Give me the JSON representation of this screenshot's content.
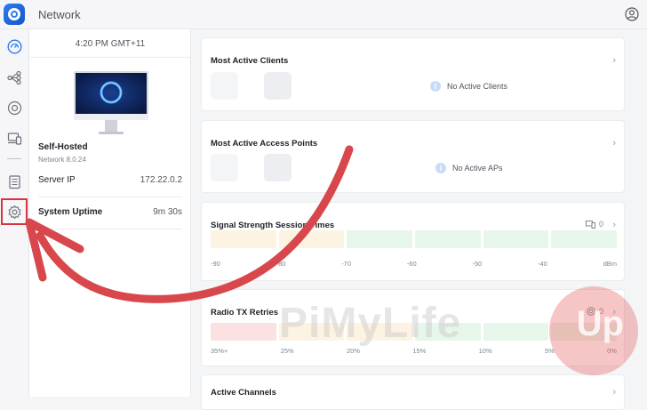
{
  "app": {
    "title": "Network"
  },
  "info": {
    "clock": "4:20 PM GMT+11",
    "device_name": "Self-Hosted",
    "device_version": "Network 8.0.24",
    "rows": [
      {
        "label": "Server IP",
        "value": "172.22.0.2"
      },
      {
        "label": "System Uptime",
        "value": "9m 30s"
      }
    ]
  },
  "cards": {
    "clients": {
      "title": "Most Active Clients",
      "empty": "No Active Clients"
    },
    "aps": {
      "title": "Most Active Access Points",
      "empty": "No Active APs"
    },
    "signal": {
      "title": "Signal Strength Session Times",
      "count": "0",
      "ticks": [
        "-90",
        "-80",
        "-70",
        "-60",
        "-50",
        "-40",
        "dBm"
      ]
    },
    "radio": {
      "title": "Radio TX Retries",
      "count": "0",
      "ticks": [
        "35%+",
        "25%",
        "20%",
        "15%",
        "10%",
        "5%",
        "0%"
      ]
    },
    "channels": {
      "title": "Active Channels"
    }
  },
  "watermark": {
    "text": "PiMyLife",
    "badge": "Up"
  },
  "icons": {
    "logo": "ubiquiti-logo-icon",
    "user": "user-account-icon",
    "nav": [
      "dashboard-icon",
      "topology-icon",
      "devices-icon",
      "client-devices-icon",
      "logs-icon",
      "settings-icon"
    ]
  },
  "colors": {
    "accent": "#2d7cf0",
    "highlight": "#d8343e",
    "bar_orange": "#fdf3e2",
    "bar_green": "#e7f6ea",
    "bar_red": "#fbe1e1"
  }
}
